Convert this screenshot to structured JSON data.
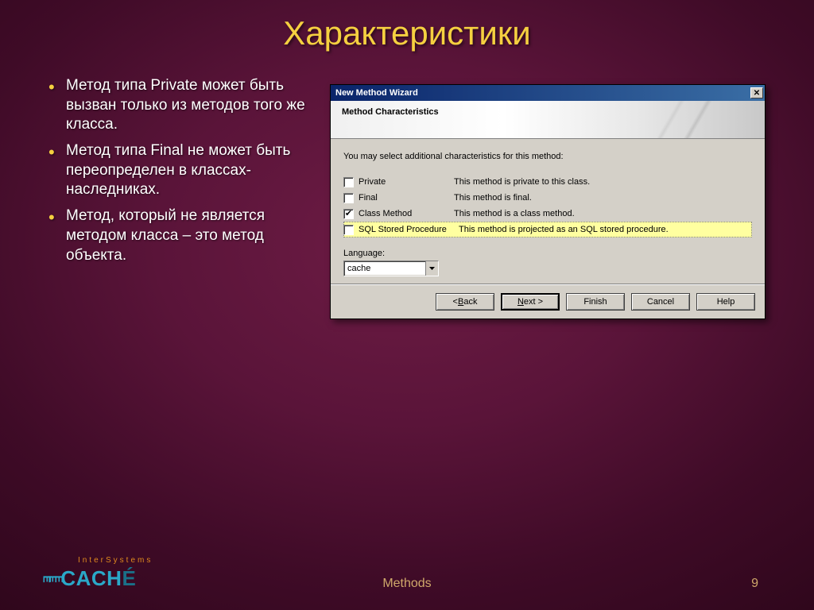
{
  "slide": {
    "title": "Характеристики",
    "bullets": [
      "Метод типа Private может быть вызван только из методов того же класса.",
      "Метод типа Final не может быть переопределен в классах-наследниках.",
      "Метод, который не является методом класса – это метод объекта."
    ],
    "footer_center": "Methods",
    "page_number": "9",
    "logo_top": "InterSystems",
    "logo_main": "CACHÉ"
  },
  "dialog": {
    "title": "New Method Wizard",
    "banner_title": "Method Characteristics",
    "instruction": "You may select additional characteristics for this method:",
    "options": [
      {
        "label": "Private",
        "desc": "This method is private to this class.",
        "checked": false,
        "highlight": false
      },
      {
        "label": "Final",
        "desc": "This method is final.",
        "checked": false,
        "highlight": false
      },
      {
        "label": "Class Method",
        "desc": "This method is a class method.",
        "checked": true,
        "highlight": false
      },
      {
        "label": "SQL Stored Procedure",
        "desc": "This method is projected as an SQL stored procedure.",
        "checked": false,
        "highlight": true
      }
    ],
    "language_label": "Language:",
    "language_value": "cache",
    "buttons": {
      "back": "< Back",
      "next": "Next >",
      "finish": "Finish",
      "cancel": "Cancel",
      "help": "Help"
    }
  }
}
